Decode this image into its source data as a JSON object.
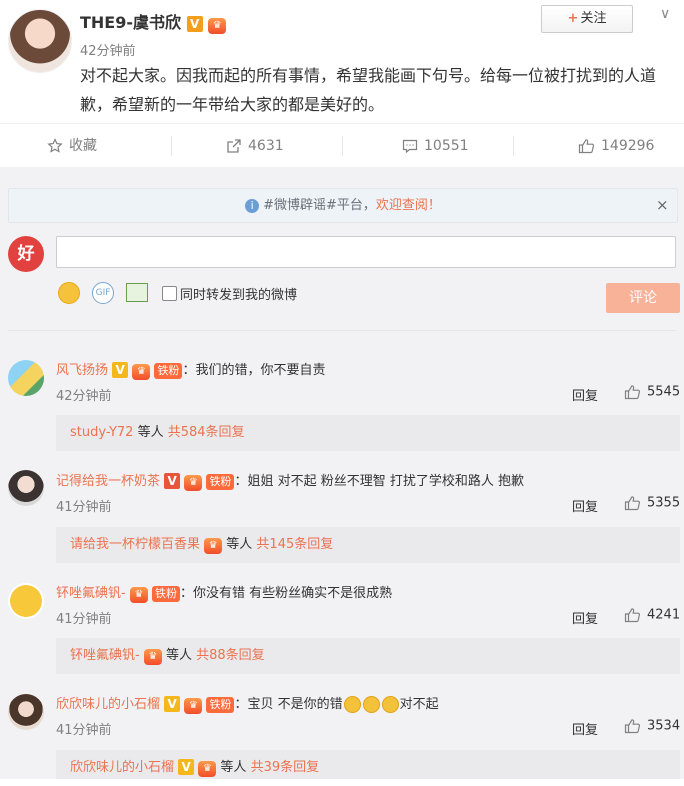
{
  "post": {
    "author": "THE9-虞书欣",
    "time": "42分钟前",
    "follow_label": "关注",
    "text": "对不起大家。因我而起的所有事情，希望我能画下句号。给每一位被打扰到的人道歉，希望新的一年带给大家的都是美好的。"
  },
  "actions": {
    "favorite": "收藏",
    "repost_count": "4631",
    "comment_count": "10551",
    "like_count": "149296"
  },
  "notice": {
    "prefix": "#微博辟谣#平台，",
    "highlight": "欢迎查阅！",
    "close": "×"
  },
  "composer": {
    "avatar_text": "好",
    "checkbox_label": "同时转发到我的微博",
    "submit_label": "评论"
  },
  "comments": [
    {
      "user": "风飞扬扬",
      "badge": "铁粉",
      "text": "：我们的错，你不要自责",
      "time": "42分钟前",
      "reply": "回复",
      "likes": "5545",
      "sub_user": "study-Y72",
      "sub_mid": " 等人 ",
      "sub_count": "共584条回复"
    },
    {
      "user": "记得给我一杯奶茶",
      "badge": "铁粉",
      "text": "：姐姐 对不起 粉丝不理智 打扰了学校和路人 抱歉",
      "time": "41分钟前",
      "reply": "回复",
      "likes": "5355",
      "sub_user": "请给我一杯柠檬百香果",
      "sub_mid": " 等人 ",
      "sub_count": "共145条回复"
    },
    {
      "user": "钚唑氟碘钒-",
      "badge": "铁粉",
      "text": "：你没有错 有些粉丝确实不是很成熟",
      "time": "41分钟前",
      "reply": "回复",
      "likes": "4241",
      "sub_user": "钚唑氟碘钒-",
      "sub_mid": " 等人 ",
      "sub_count": "共88条回复"
    },
    {
      "user": "欣欣味儿的小石榴",
      "badge": "铁粉",
      "text": "：宝贝 不是你的错",
      "text_tail": "对不起",
      "time": "41分钟前",
      "reply": "回复",
      "likes": "3534",
      "sub_user": "欣欣味儿的小石榴",
      "sub_mid": " 等人 ",
      "sub_count": "共39条回复"
    }
  ],
  "colors": {
    "accent": "#eb7350",
    "comment_bg": "#f2f2f5",
    "submit_bg": "#f7b298"
  }
}
